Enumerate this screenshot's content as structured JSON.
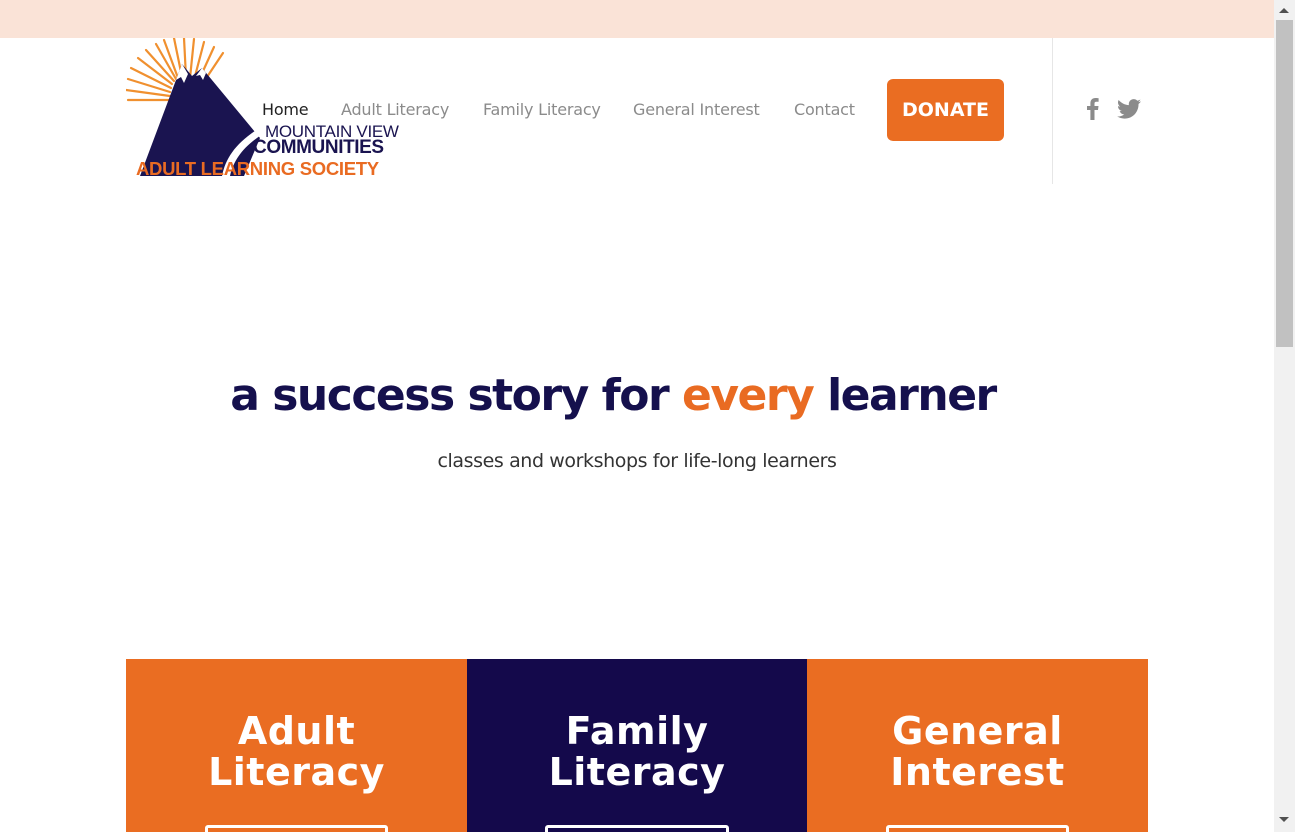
{
  "brand": {
    "line1": "MOUNTAIN VIEW",
    "line2": "COMMUNITIES",
    "line3": "ADULT LEARNING SOCIETY"
  },
  "nav": {
    "items": [
      {
        "label": "Home",
        "active": true
      },
      {
        "label": "Adult Literacy",
        "active": false
      },
      {
        "label": "Family Literacy",
        "active": false
      },
      {
        "label": "General Interest",
        "active": false
      },
      {
        "label": "Contact",
        "active": false
      }
    ],
    "donate_label": "DONATE"
  },
  "social": {
    "icons": [
      "facebook-icon",
      "twitter-icon"
    ]
  },
  "hero": {
    "title_before": "a success story for ",
    "title_accent": "every",
    "title_after": " learner",
    "subtitle": "classes and workshops for life-long learners"
  },
  "cards": [
    {
      "title_line1": "Adult",
      "title_line2": "Literacy",
      "color": "#ea6d22"
    },
    {
      "title_line1": "Family",
      "title_line2": "Literacy",
      "color": "#14094b"
    },
    {
      "title_line1": "General",
      "title_line2": "Interest",
      "color": "#ea6d22"
    }
  ],
  "colors": {
    "accent": "#ea6d22",
    "navy": "#14094b",
    "topbar": "#fae3d7"
  }
}
